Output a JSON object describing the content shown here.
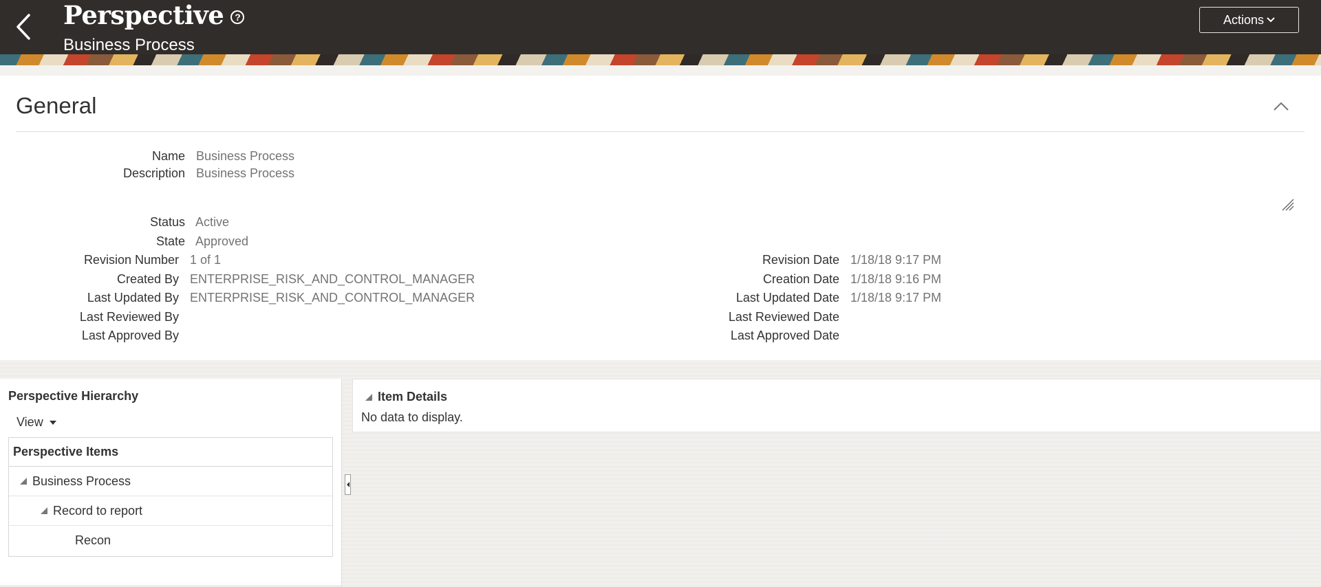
{
  "header": {
    "title": "Perspective",
    "subtitle": "Business Process",
    "actions_label": "Actions",
    "help_glyph": "?"
  },
  "general": {
    "title": "General",
    "fields_top": [
      {
        "label": "Name",
        "value": "Business Process"
      },
      {
        "label": "Description",
        "value": "Business Process"
      },
      {
        "label": "Status",
        "value": "Active"
      },
      {
        "label": "State",
        "value": "Approved"
      }
    ],
    "fields_left": [
      {
        "label": "Revision Number",
        "value": "1 of 1"
      },
      {
        "label": "Created By",
        "value": "ENTERPRISE_RISK_AND_CONTROL_MANAGER"
      },
      {
        "label": "Last Updated By",
        "value": "ENTERPRISE_RISK_AND_CONTROL_MANAGER"
      },
      {
        "label": "Last Reviewed By",
        "value": ""
      },
      {
        "label": "Last Approved By",
        "value": ""
      }
    ],
    "fields_right": [
      {
        "label": "Revision Date",
        "value": "1/18/18 9:17 PM"
      },
      {
        "label": "Creation Date",
        "value": "1/18/18 9:16 PM"
      },
      {
        "label": "Last Updated Date",
        "value": "1/18/18 9:17 PM"
      },
      {
        "label": "Last Reviewed Date",
        "value": ""
      },
      {
        "label": "Last Approved Date",
        "value": ""
      }
    ]
  },
  "hierarchy": {
    "title": "Perspective Hierarchy",
    "view_label": "View",
    "column_header": "Perspective Items",
    "rows": [
      {
        "label": "Business Process",
        "level": 0,
        "expanded": true
      },
      {
        "label": "Record to report",
        "level": 1,
        "expanded": true
      },
      {
        "label": "Recon",
        "level": 2,
        "expanded": false
      }
    ]
  },
  "details": {
    "title": "Item Details",
    "empty_text": "No data to display."
  },
  "icons": {
    "back": "chevron-left-icon",
    "help": "question-circle-icon",
    "actions": "chevron-down-icon",
    "collapse": "chevron-up-icon",
    "resize": "resize-handle-icon",
    "view": "caret-down-icon",
    "splitter": "caret-left-icon"
  }
}
